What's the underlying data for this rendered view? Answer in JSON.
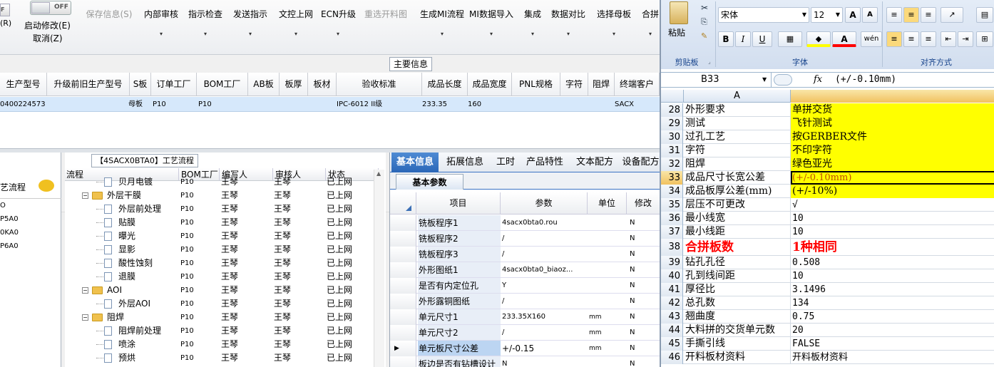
{
  "toolbar": {
    "left_cut": "(R)",
    "toggle_off": "OFF",
    "enable_edit": "启动修改(E)",
    "cancel": "取消(Z)",
    "buttons": [
      {
        "label": "保存信息(S)",
        "disabled": true
      },
      {
        "label": "内部审核"
      },
      {
        "label": "指示检查"
      },
      {
        "label": "发送指示"
      },
      {
        "label": "文控上网"
      },
      {
        "label": "ECN升级"
      },
      {
        "label": "重选开料图",
        "disabled": true
      },
      {
        "label": "生成MI流程"
      },
      {
        "label": "MI数据导入"
      },
      {
        "label": "集成"
      },
      {
        "label": "数据对比"
      },
      {
        "label": "选择母板"
      },
      {
        "label": "合拼"
      }
    ]
  },
  "main_info": {
    "title": "主要信息",
    "headers": [
      "生产型号",
      "升级前旧生产型号",
      "S板",
      "订单工厂",
      "BOM工厂",
      "AB板",
      "板厚",
      "板材",
      "验收标准",
      "成品长度",
      "成品宽度",
      "PNL规格",
      "字符",
      "阻焊",
      "终端客户"
    ],
    "row": [
      "0400224573",
      "",
      "母板",
      "P10",
      "P10",
      "",
      "",
      "",
      "IPC-6012 II级",
      "233.35",
      "160",
      "",
      "",
      "",
      "SACX"
    ]
  },
  "left_panel": {
    "label": "艺流程",
    "items": [
      "O",
      "P5A0",
      "0KA0",
      "P6A0"
    ]
  },
  "tree": {
    "title": "【4SACX0BTA0】工艺流程",
    "headers": [
      "流程",
      "BOM工厂",
      "编写人",
      "审核人",
      "状态"
    ],
    "rows": [
      {
        "name": "贝月电镀",
        "kind": "doc",
        "level": 2,
        "bom": "P10",
        "writer": "王琴",
        "status": "已上网"
      },
      {
        "name": "外层干膜",
        "kind": "folder",
        "level": 1,
        "bom": "P10",
        "writer": "王琴",
        "status": "已上网"
      },
      {
        "name": "外层前处理",
        "kind": "doc",
        "level": 2,
        "bom": "P10",
        "writer": "王琴",
        "status": "已上网"
      },
      {
        "name": "贴膜",
        "kind": "doc",
        "level": 2,
        "bom": "P10",
        "writer": "王琴",
        "status": "已上网"
      },
      {
        "name": "曝光",
        "kind": "doc",
        "level": 2,
        "bom": "P10",
        "writer": "王琴",
        "status": "已上网"
      },
      {
        "name": "显影",
        "kind": "doc",
        "level": 2,
        "bom": "P10",
        "writer": "王琴",
        "status": "已上网"
      },
      {
        "name": "酸性蚀刻",
        "kind": "doc",
        "level": 2,
        "bom": "P10",
        "writer": "王琴",
        "status": "已上网"
      },
      {
        "name": "退膜",
        "kind": "doc",
        "level": 2,
        "bom": "P10",
        "writer": "王琴",
        "status": "已上网"
      },
      {
        "name": "AOI",
        "kind": "folder",
        "level": 1,
        "bom": "P10",
        "writer": "王琴",
        "status": "已上网"
      },
      {
        "name": "外层AOI",
        "kind": "doc",
        "level": 2,
        "bom": "P10",
        "writer": "王琴",
        "status": "已上网"
      },
      {
        "name": "阻焊",
        "kind": "folder",
        "level": 1,
        "bom": "P10",
        "writer": "王琴",
        "status": "已上网"
      },
      {
        "name": "阻焊前处理",
        "kind": "doc",
        "level": 2,
        "bom": "P10",
        "writer": "王琴",
        "status": "已上网"
      },
      {
        "name": "喷涂",
        "kind": "doc",
        "level": 2,
        "bom": "P10",
        "writer": "王琴",
        "status": "已上网"
      },
      {
        "name": "预烘",
        "kind": "doc",
        "level": 2,
        "bom": "P10",
        "writer": "王琴",
        "status": "已上网"
      }
    ]
  },
  "right_panel": {
    "tabs": [
      "基本信息",
      "拓展信息",
      "工时",
      "产品特性",
      "文本配方",
      "设备配方"
    ],
    "subtab": "基本参数",
    "headers": [
      "项目",
      "参数",
      "单位",
      "修改"
    ],
    "rows": [
      {
        "item": "铣板程序1",
        "param": "4sacx0bta0.rou",
        "unit": "",
        "mod": "N"
      },
      {
        "item": "铣板程序2",
        "param": "/",
        "unit": "",
        "mod": "N"
      },
      {
        "item": "铣板程序3",
        "param": "/",
        "unit": "",
        "mod": "N"
      },
      {
        "item": "外形图纸1",
        "param": "4sacx0bta0_biaoz...",
        "unit": "",
        "mod": "N"
      },
      {
        "item": "是否有内定位孔",
        "param": "Y",
        "unit": "",
        "mod": "N"
      },
      {
        "item": "外形露铜图纸",
        "param": "/",
        "unit": "",
        "mod": "N"
      },
      {
        "item": "单元尺寸1",
        "param": "233.35X160",
        "unit": "mm",
        "mod": "N"
      },
      {
        "item": "单元尺寸2",
        "param": "/",
        "unit": "mm",
        "mod": "N"
      },
      {
        "item": "单元板尺寸公差",
        "param": "+/-0.15",
        "unit": "mm",
        "mod": "N",
        "selected": true
      },
      {
        "item": "板边是否有钻槽设计",
        "param": "N",
        "unit": "",
        "mod": "N"
      }
    ]
  },
  "excel": {
    "clipboard": {
      "paste": "粘贴",
      "group": "剪贴板"
    },
    "font": {
      "name": "宋体",
      "size": "12",
      "group": "字体",
      "bold": "B",
      "italic": "I",
      "underline": "U"
    },
    "align_group": "对齐方式",
    "name_box": "B33",
    "fx": "fx",
    "formula": "(+/-0.10mm)",
    "col_a": "A",
    "highlight_color": "#ffff00",
    "red_color": "#ff0000",
    "rows": [
      {
        "n": "28",
        "a": "外形要求",
        "b": "单拼交货",
        "yellow": true
      },
      {
        "n": "29",
        "a": "测试",
        "b": "飞针测试",
        "yellow": true
      },
      {
        "n": "30",
        "a": "过孔工艺",
        "b": "按GERBER文件",
        "yellow": true
      },
      {
        "n": "31",
        "a": "字符",
        "b": "不印字符",
        "yellow": true
      },
      {
        "n": "32",
        "a": "阻焊",
        "b": "绿色亚光",
        "yellow": true
      },
      {
        "n": "33",
        "a": "成品尺寸长宽公差",
        "b": "(+/-0.10mm)",
        "yellow": true,
        "active": true
      },
      {
        "n": "34",
        "a": "成品板厚公差(mm)",
        "b": "(+/-10%)",
        "yellow": true
      },
      {
        "n": "35",
        "a": "层压不可更改",
        "b": "√"
      },
      {
        "n": "36",
        "a": "最小线宽",
        "b": "10"
      },
      {
        "n": "37",
        "a": "最小线距",
        "b": "10"
      },
      {
        "n": "38",
        "a": "合拼板数",
        "b": "1种相同",
        "red": true
      },
      {
        "n": "39",
        "a": "钻孔孔径",
        "b": "0.508"
      },
      {
        "n": "40",
        "a": "孔到线间距",
        "b": "10"
      },
      {
        "n": "41",
        "a": "厚径比",
        "b": "3.1496"
      },
      {
        "n": "42",
        "a": "总孔数",
        "b": "134"
      },
      {
        "n": "43",
        "a": "翘曲度",
        "b": "0.75"
      },
      {
        "n": "44",
        "a": "大料拼的交货单元数",
        "b": "20"
      },
      {
        "n": "45",
        "a": "手撕引线",
        "b": "FALSE"
      },
      {
        "n": "46",
        "a": "开料板材资料",
        "b": "开料板材资料"
      }
    ]
  }
}
